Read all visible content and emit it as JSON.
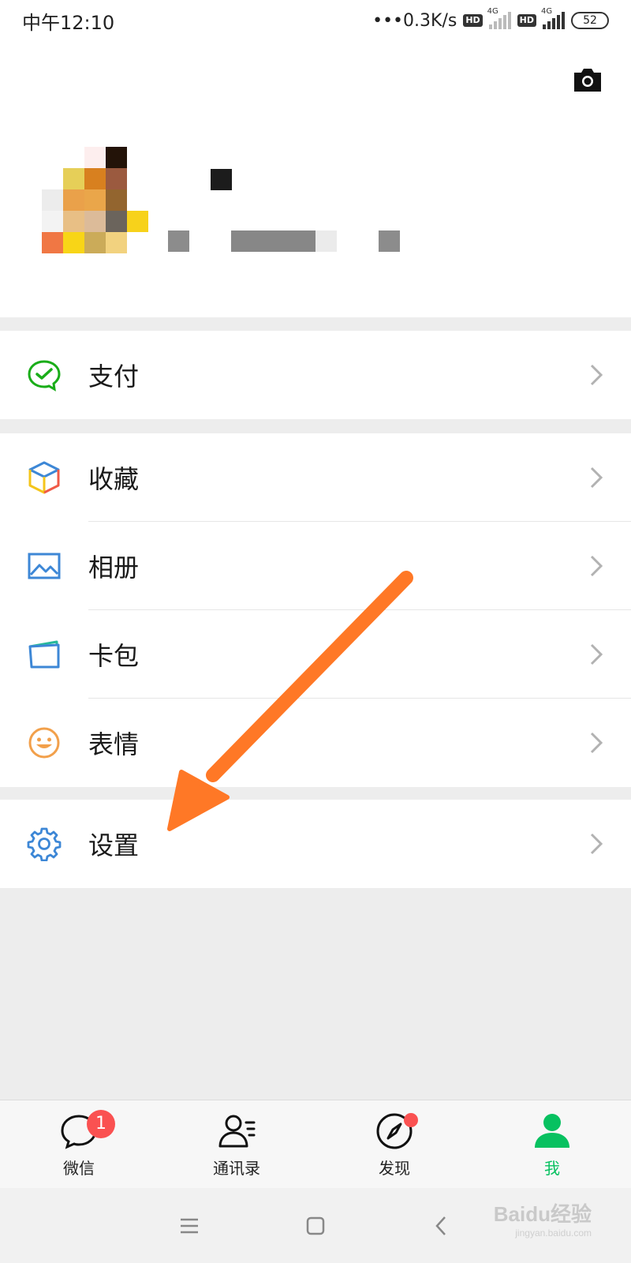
{
  "status_bar": {
    "time": "中午12:10",
    "speed": "•••0.3K/s",
    "hd1": "HD",
    "net1": "4G",
    "hd2": "HD",
    "net2": "4G",
    "battery": "52"
  },
  "menu": {
    "pay": {
      "label": "支付",
      "icon": "wechat-pay-icon"
    },
    "favorites": {
      "label": "收藏",
      "icon": "cube-icon"
    },
    "album": {
      "label": "相册",
      "icon": "image-icon"
    },
    "cards": {
      "label": "卡包",
      "icon": "wallet-card-icon"
    },
    "stickers": {
      "label": "表情",
      "icon": "smiley-icon"
    },
    "settings": {
      "label": "设置",
      "icon": "gear-icon"
    }
  },
  "tabs": [
    {
      "label": "微信",
      "badge": "1"
    },
    {
      "label": "通讯录"
    },
    {
      "label": "发现"
    },
    {
      "label": "我"
    }
  ],
  "colors": {
    "accent": "#07c160",
    "badge": "#fa5151",
    "arrow": "#ff7826"
  },
  "watermark": {
    "brand": "Baidu经验",
    "url": "jingyan.baidu.com"
  }
}
